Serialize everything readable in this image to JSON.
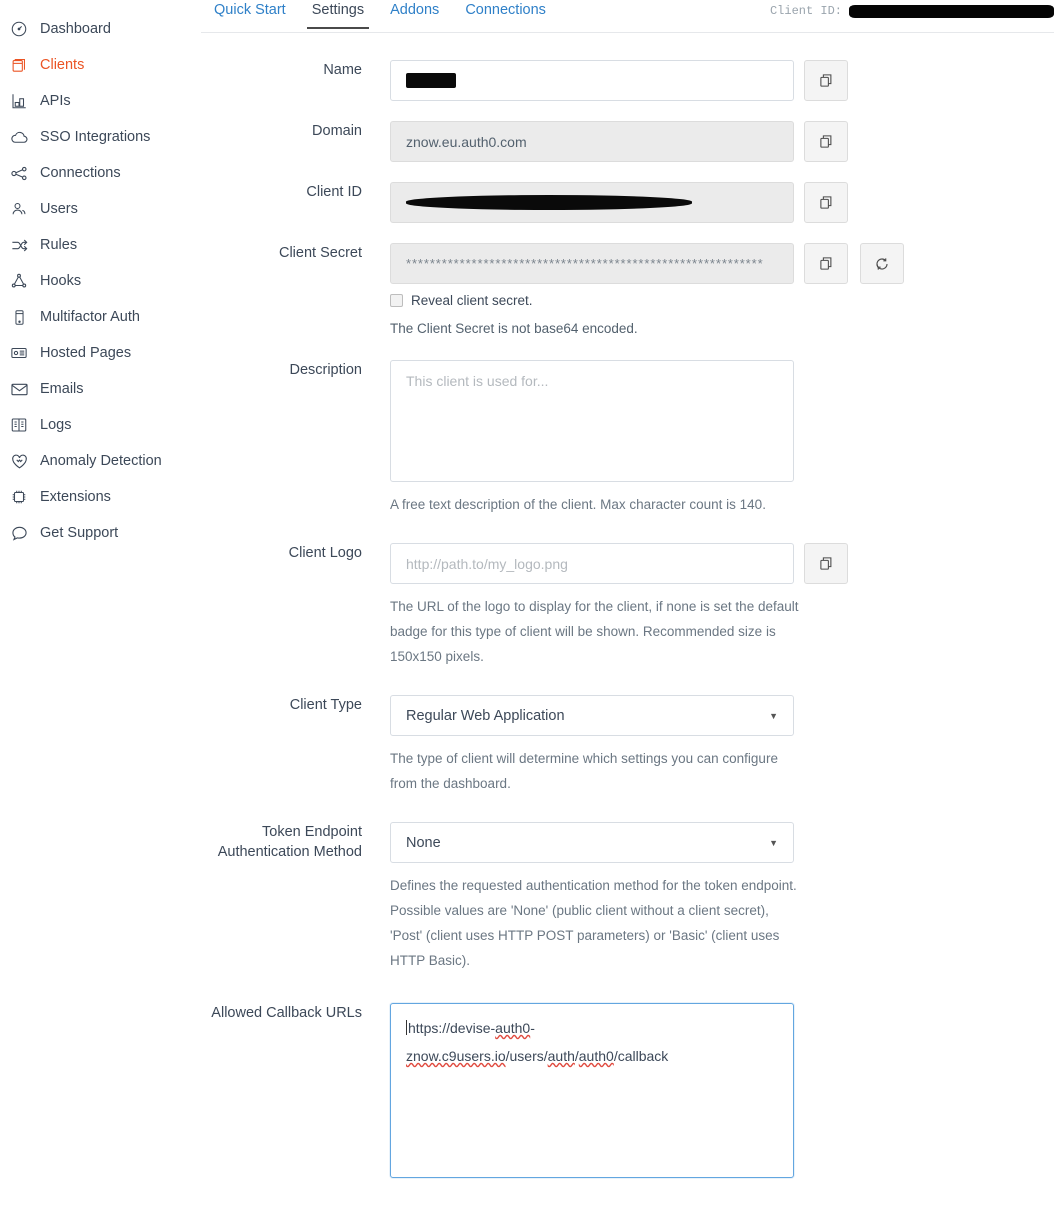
{
  "sidebar": {
    "items": [
      {
        "label": "Dashboard",
        "icon": "gauge-icon",
        "active": false
      },
      {
        "label": "Clients",
        "icon": "clients-icon",
        "active": true
      },
      {
        "label": "APIs",
        "icon": "apis-icon",
        "active": false
      },
      {
        "label": "SSO Integrations",
        "icon": "cloud-icon",
        "active": false
      },
      {
        "label": "Connections",
        "icon": "connections-icon",
        "active": false
      },
      {
        "label": "Users",
        "icon": "users-icon",
        "active": false
      },
      {
        "label": "Rules",
        "icon": "rules-icon",
        "active": false
      },
      {
        "label": "Hooks",
        "icon": "hooks-icon",
        "active": false
      },
      {
        "label": "Multifactor Auth",
        "icon": "mobile-icon",
        "active": false
      },
      {
        "label": "Hosted Pages",
        "icon": "hosted-pages-icon",
        "active": false
      },
      {
        "label": "Emails",
        "icon": "envelope-icon",
        "active": false
      },
      {
        "label": "Logs",
        "icon": "logs-icon",
        "active": false
      },
      {
        "label": "Anomaly Detection",
        "icon": "heart-shield-icon",
        "active": false
      },
      {
        "label": "Extensions",
        "icon": "chip-icon",
        "active": false
      },
      {
        "label": "Get Support",
        "icon": "speech-bubble-icon",
        "active": false
      }
    ]
  },
  "tabs": [
    {
      "label": "Quick Start",
      "active": false
    },
    {
      "label": "Settings",
      "active": true
    },
    {
      "label": "Addons",
      "active": false
    },
    {
      "label": "Connections",
      "active": false
    }
  ],
  "header": {
    "client_id_label": "Client ID:",
    "client_id_value": "[redacted]"
  },
  "colors": {
    "accent": "#eb5424",
    "link": "#2f80c8",
    "text": "#3c4858",
    "help": "#6b7783",
    "focus_border": "#63a6e0"
  },
  "form": {
    "name": {
      "label": "Name",
      "value": "[redacted]",
      "copy_button": "copy-icon"
    },
    "domain": {
      "label": "Domain",
      "value": "znow.eu.auth0.com",
      "copy_button": "copy-icon"
    },
    "client_id": {
      "label": "Client ID",
      "value": "[redacted]",
      "copy_button": "copy-icon"
    },
    "client_secret": {
      "label": "Client Secret",
      "value": "************************************************************",
      "copy_button": "copy-icon",
      "rotate_button": "rotate-icon",
      "reveal_checkbox_label": "Reveal client secret.",
      "reveal_checked": false,
      "note": "The Client Secret is not base64 encoded."
    },
    "description": {
      "label": "Description",
      "value": "",
      "placeholder": "This client is used for...",
      "help": "A free text description of the client. Max character count is 140."
    },
    "client_logo": {
      "label": "Client Logo",
      "value": "",
      "placeholder": "http://path.to/my_logo.png",
      "copy_button": "copy-icon",
      "help": "The URL of the logo to display for the client, if none is set the default badge for this type of client will be shown. Recommended size is 150x150 pixels."
    },
    "client_type": {
      "label": "Client Type",
      "value": "Regular Web Application",
      "help": "The type of client will determine which settings you can configure from the dashboard."
    },
    "token_endpoint_auth_method": {
      "label_line1": "Token Endpoint",
      "label_line2": "Authentication Method",
      "value": "None",
      "help": "Defines the requested authentication method for the token endpoint. Possible values are 'None' (public client without a client secret), 'Post' (client uses HTTP POST parameters) or 'Basic' (client uses HTTP Basic)."
    },
    "allowed_callback_urls": {
      "label": "Allowed Callback URLs",
      "value": "https://devise-auth0-znow.c9users.io/users/auth/auth0/callback",
      "focused": true
    }
  }
}
